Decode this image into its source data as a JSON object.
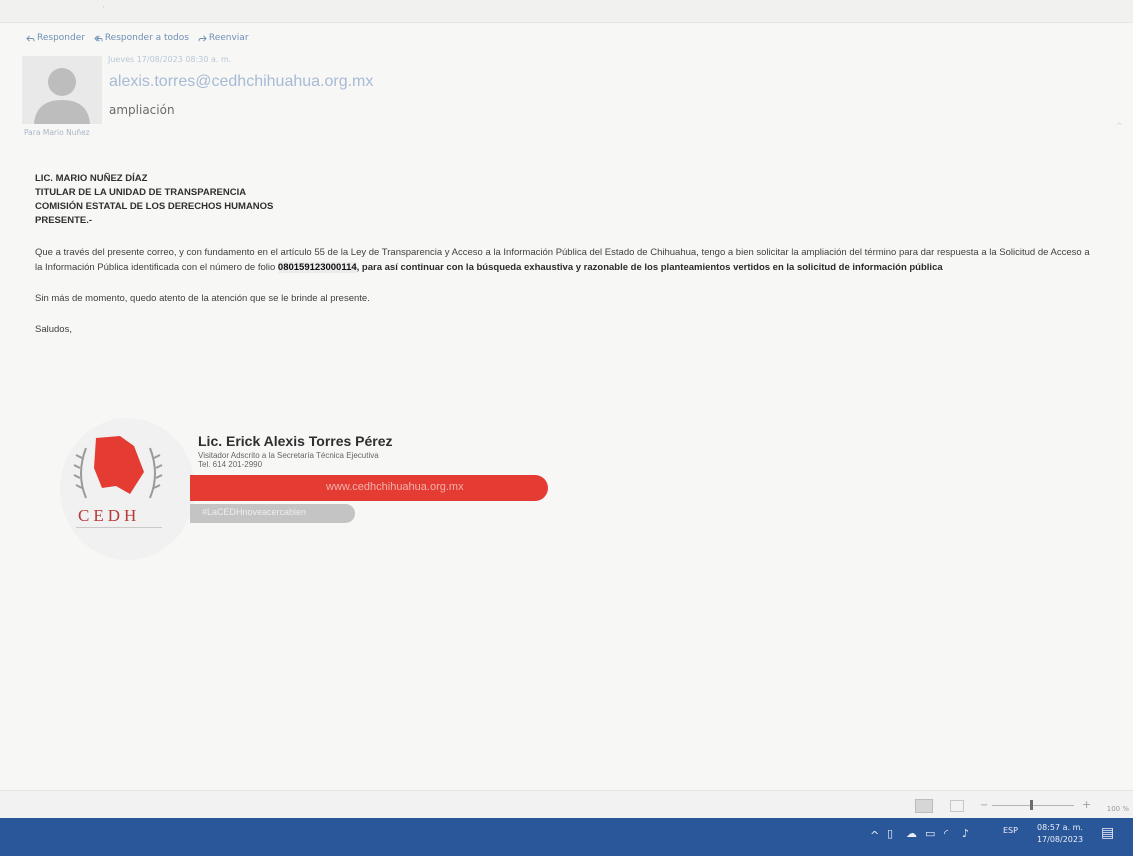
{
  "email": {
    "actions": [
      {
        "label": "Responder"
      },
      {
        "label": "Responder a todos"
      },
      {
        "label": "Reenviar"
      }
    ],
    "date": "Jueves 17/08/2023 08:30 a. m.",
    "from": "alexis.torres@cedhchihuahua.org.mx",
    "subject": "ampliación",
    "to_label": "Para",
    "to_value": "Mario Nuñez"
  },
  "body": {
    "address": [
      "LIC. MARIO NUÑEZ DÍAZ",
      "TITULAR DE LA UNIDAD DE TRANSPARENCIA",
      "COMISIÓN ESTATAL DE LOS DERECHOS HUMANOS",
      "PRESENTE.-"
    ],
    "paragraph_part1": "Que a través del presente correo, y con fundamento en el artículo 55 de la Ley de Transparencia y Acceso a la Información Pública del Estado de Chihuahua, tengo a bien solicitar la ampliación del término para dar respuesta a la Solicitud de Acceso a la Información Pública identificada con el número de folio ",
    "folio": "080159123000114",
    "paragraph_part2": ", para así continuar con la búsqueda exhaustiva y razonable de los planteamientos vertidos en la solicitud de información pública",
    "closing": "Sin más de momento, quedo atento de la atención que se le brinde al presente.",
    "salutation": "Saludos,"
  },
  "signature": {
    "name": "Lic. Erick Alexis Torres Pérez",
    "role": "Visitador Adscrito a la Secretaría Técnica Ejecutiva",
    "tel": "Tel. 614 201-2990",
    "website": "www.cedhchihuahua.org.mx",
    "hashtag": "#LaCEDHnoveacercabien",
    "logo_text": "CEDH",
    "colors": {
      "red": "#e43b33",
      "grey": "#c4c4c4"
    }
  },
  "statusbar": {
    "zoom": "100 %"
  },
  "taskbar": {
    "language": "ESP",
    "time": "08:57 a. m.",
    "date": "17/08/2023",
    "color": "#2a5799"
  }
}
